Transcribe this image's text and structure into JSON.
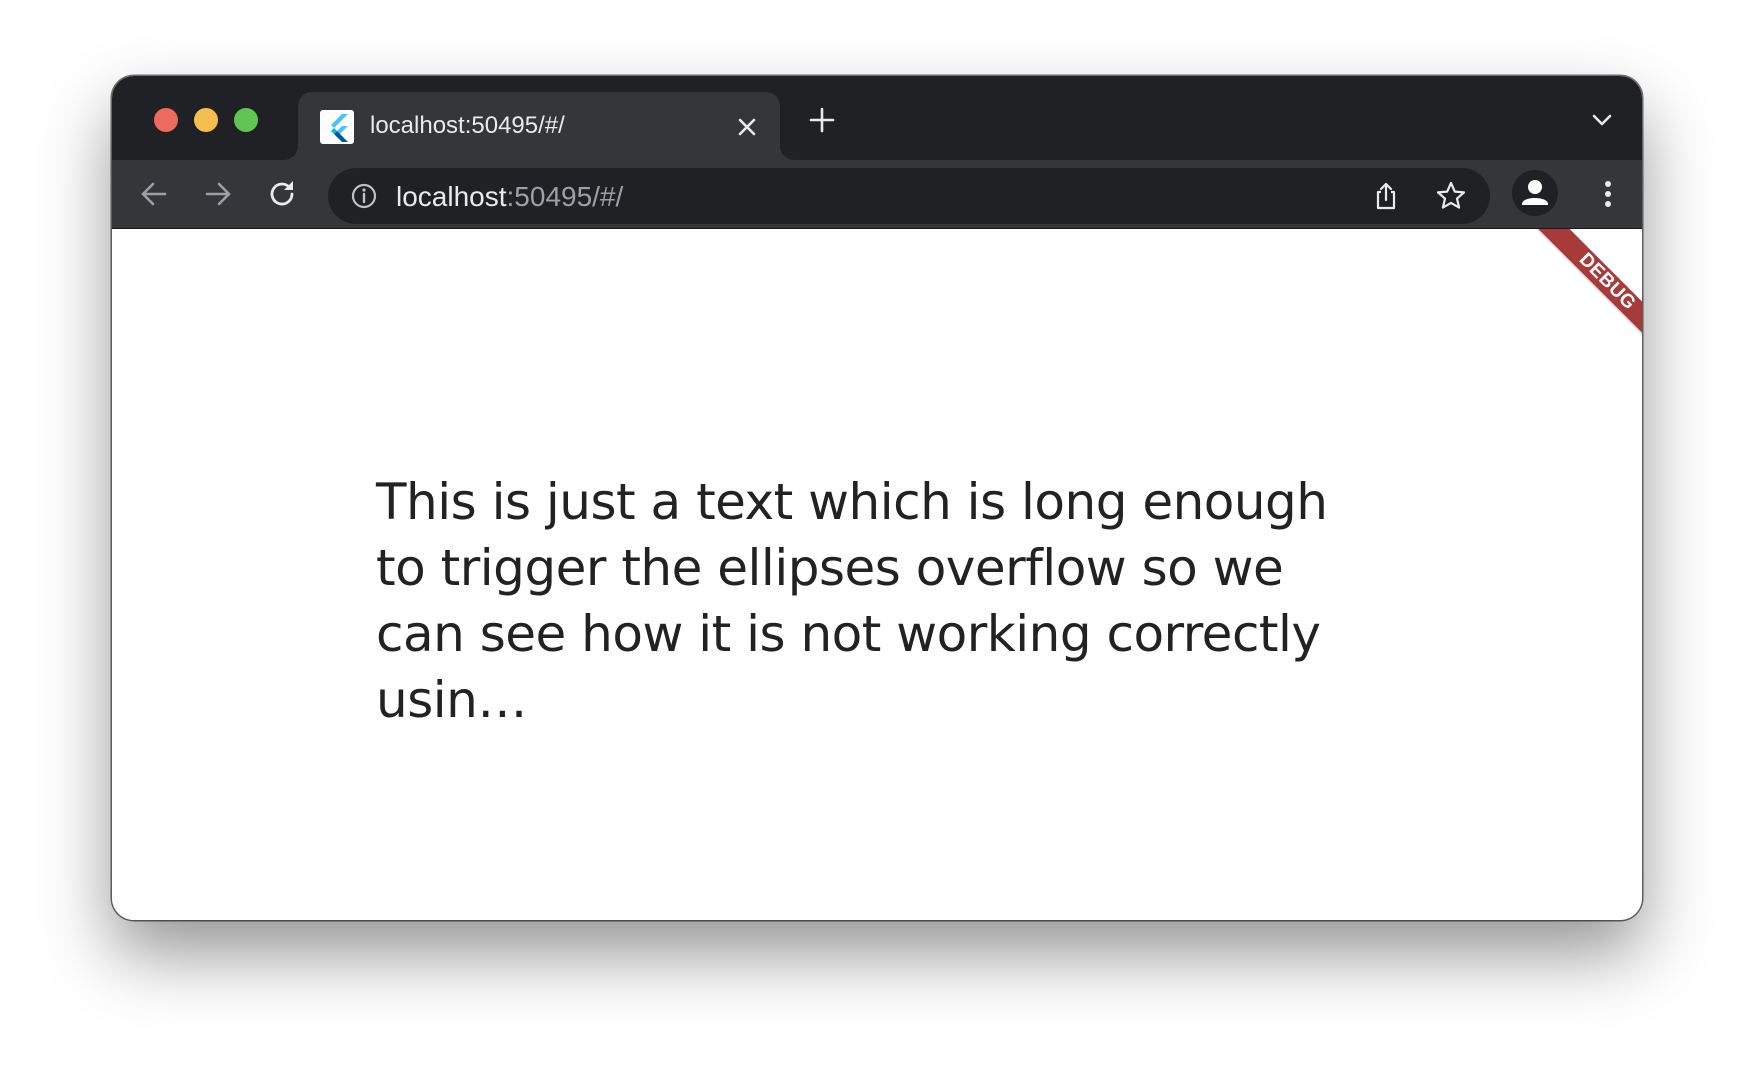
{
  "browser": {
    "tab": {
      "title": "localhost:50495/#/",
      "favicon": "flutter-logo-icon"
    },
    "address_bar": {
      "host": "localhost",
      "path": ":50495/#/"
    },
    "icons": {
      "back": "arrow-left-icon",
      "forward": "arrow-right-icon",
      "reload": "reload-icon",
      "info": "info-icon",
      "share": "share-icon",
      "bookmark": "star-icon",
      "profile": "profile-icon",
      "menu": "kebab-menu-icon",
      "new_tab": "plus-icon",
      "tab_search": "chevron-down-icon",
      "tab_close": "close-icon"
    },
    "colors": {
      "chrome_dark": "#202124",
      "chrome_mid": "#35363a",
      "close": "#ed6a5e",
      "minimize": "#f4bf4f",
      "maximize": "#61c554"
    }
  },
  "page": {
    "body_text": "This is just a text which is long enough to trigger the ellipses overflow so we can see how it is not working correctly usin…",
    "debug_banner": "DEBUG",
    "debug_banner_color": "#a83a3a"
  }
}
